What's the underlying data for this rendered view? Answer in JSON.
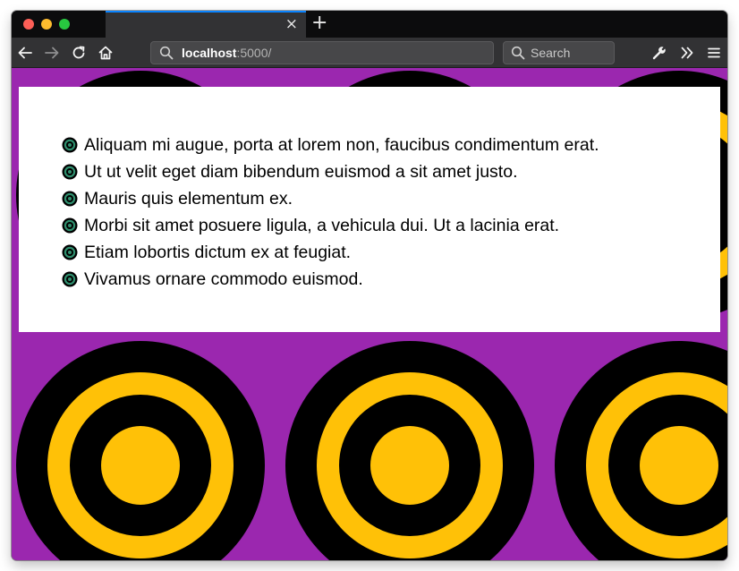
{
  "browser": {
    "new_tab_label": "+",
    "tab_close_label": "×",
    "url": {
      "host": "localhost",
      "rest": ":5000/"
    },
    "search": {
      "placeholder": "Search"
    }
  },
  "page": {
    "items": [
      "Aliquam mi augue, porta at lorem non, faucibus condimentum erat.",
      "Ut ut velit eget diam bibendum euismod a sit amet justo.",
      "Mauris quis elementum ex.",
      "Morbi sit amet posuere ligula, a vehicula dui. Ut a lacinia erat.",
      "Etiam lobortis dictum ex at feugiat.",
      "Vivamus ornare commodo euismod."
    ]
  },
  "colors": {
    "background": "#9b27af",
    "target_yellow": "#ffc107",
    "target_black": "#000000",
    "bullet_fill": "#2f8f6e",
    "accent": "#0a84ff"
  }
}
